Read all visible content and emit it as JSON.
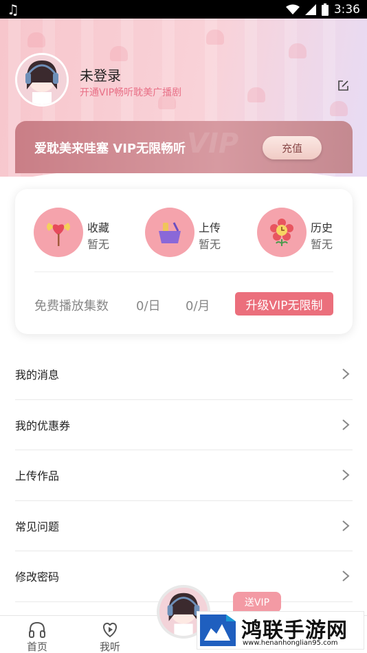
{
  "status_bar": {
    "time": "3:36"
  },
  "profile": {
    "name": "未登录",
    "subtitle": "开通VIP畅听耽美广播剧"
  },
  "vip_banner": {
    "text": "爱耽美来哇塞 VIP无限畅听",
    "button_label": "充值"
  },
  "stats": [
    {
      "label": "收藏",
      "value": "暂无",
      "icon": "heart-lollipop-icon"
    },
    {
      "label": "上传",
      "value": "暂无",
      "icon": "basket-icon"
    },
    {
      "label": "历史",
      "value": "暂无",
      "icon": "flower-clock-icon"
    }
  ],
  "free_play": {
    "label": "免费播放集数",
    "per_day": "0/日",
    "per_month": "0/月",
    "upgrade_label": "升级VIP无限制"
  },
  "menu": [
    "我的消息",
    "我的优惠券",
    "上传作品",
    "常见问题",
    "修改密码"
  ],
  "bottom_nav": {
    "home_label": "首页",
    "listen_label": "我听",
    "gift_vip_label": "送VIP"
  },
  "watermark": {
    "title": "鸿联手游网",
    "url": "www.henanhonglian95.com"
  },
  "colors": {
    "accent_pink": "#eb6f7c",
    "subtitle_pink": "#e86f86",
    "icon_circle": "#f5a3ac"
  }
}
